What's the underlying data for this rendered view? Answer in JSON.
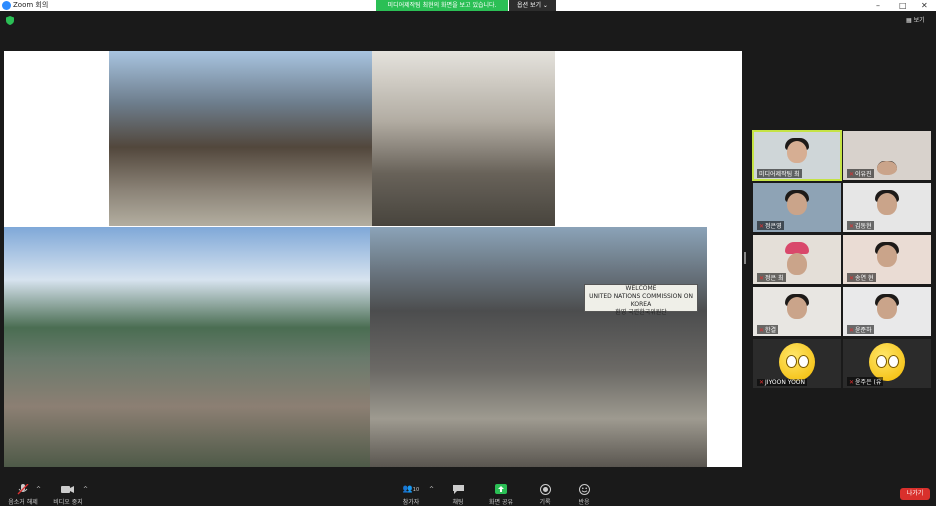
{
  "window": {
    "title": "Zoom 회의",
    "controls": [
      "–",
      "□",
      "✕"
    ]
  },
  "share": {
    "banner": "미디어제작팀 최현의 화면을 보고 있습니다.",
    "view_options": "옵션 보기 ⌄"
  },
  "top_right": {
    "view": "보기"
  },
  "shared_screen": {
    "sign_line1": "WELCOME",
    "sign_line2": "UNITED NATIONS COMMISSION ON KOREA",
    "sign_line3": "환영 국련한국위원단"
  },
  "participants": [
    {
      "name": "미디어제작팀 최",
      "active": true,
      "muted": false,
      "emoji": false
    },
    {
      "name": "이유진",
      "active": false,
      "muted": true,
      "emoji": false
    },
    {
      "name": "정은영",
      "active": false,
      "muted": true,
      "emoji": false
    },
    {
      "name": "김동현",
      "active": false,
      "muted": true,
      "emoji": false
    },
    {
      "name": "정은 최",
      "active": false,
      "muted": true,
      "emoji": false
    },
    {
      "name": "송연 현",
      "active": false,
      "muted": true,
      "emoji": false
    },
    {
      "name": "한결",
      "active": false,
      "muted": true,
      "emoji": false
    },
    {
      "name": "윤준하",
      "active": false,
      "muted": true,
      "emoji": false
    },
    {
      "name": "JIYOON YOON",
      "active": false,
      "muted": true,
      "emoji": true
    },
    {
      "name": "윤주은 (유",
      "active": false,
      "muted": true,
      "emoji": true
    }
  ],
  "toolbar": {
    "mute": "음소거 해제",
    "video": "비디오 중지",
    "participants": "참가자",
    "participants_count": "10",
    "chat": "채팅",
    "share": "화면 공유",
    "record": "기록",
    "reactions": "반응",
    "leave": "나가기"
  },
  "colors": {
    "share_banner": "#2bbf55",
    "active_speaker": "#c5e345",
    "leave": "#d9302c",
    "share_icon": "#2bbf55"
  }
}
